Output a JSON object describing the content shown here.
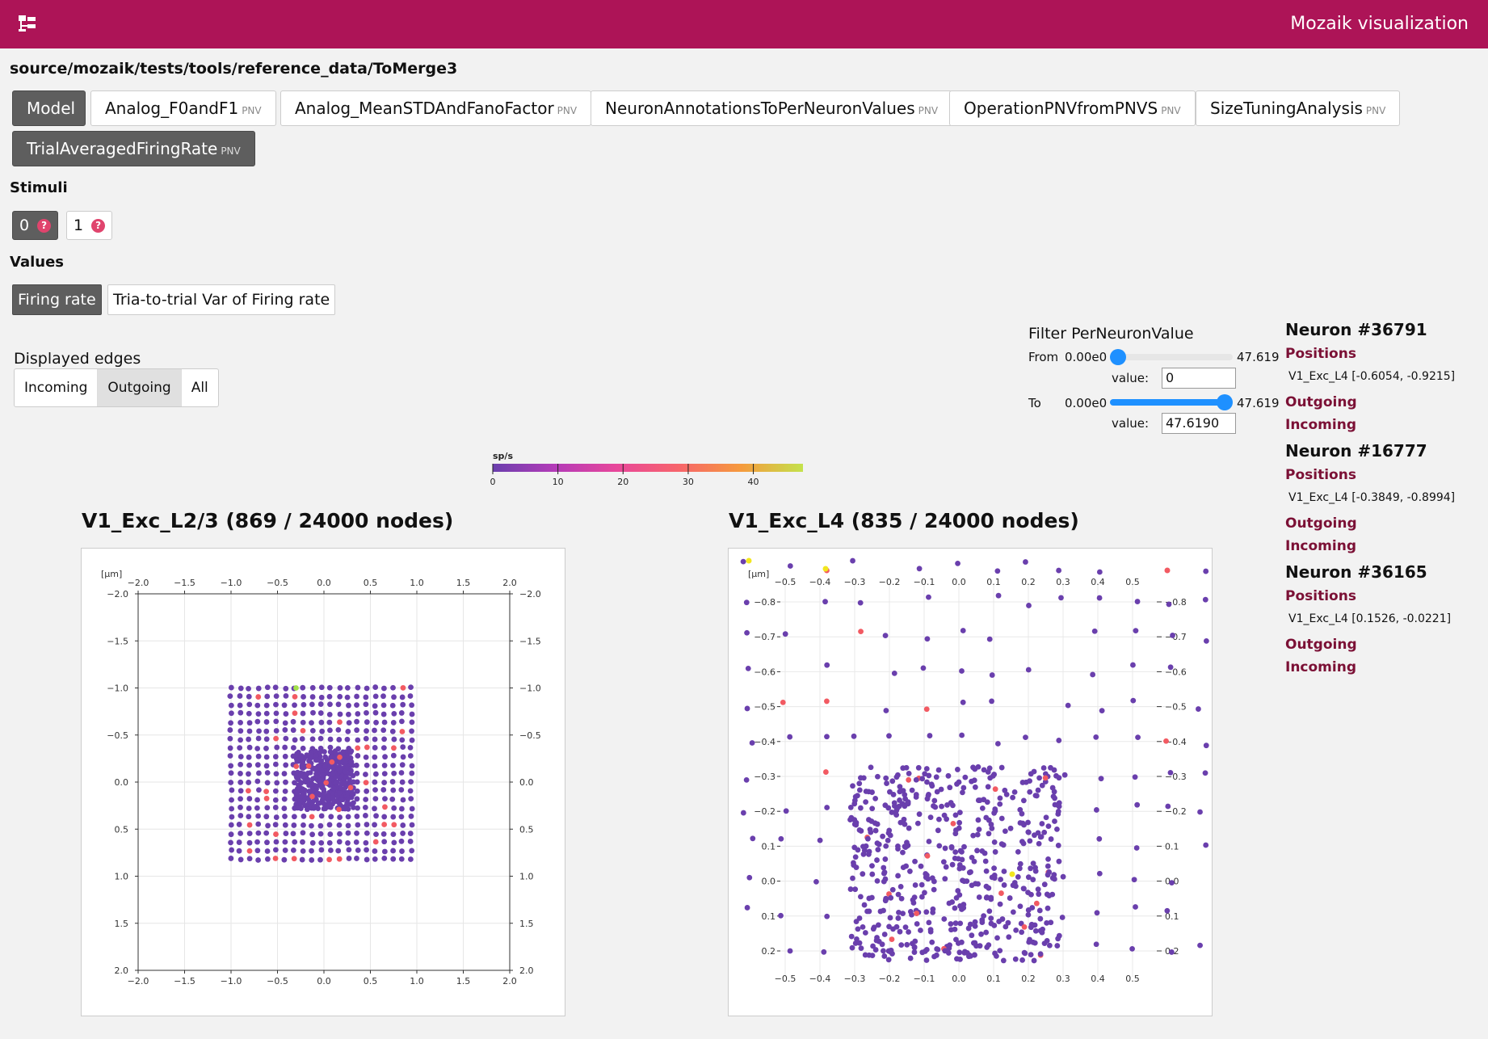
{
  "header": {
    "app_title": "Mozaik visualization",
    "menu_icon": "tree-menu-icon"
  },
  "path": "source/mozaik/tests/tools/reference_data/ToMerge3",
  "tabs": [
    {
      "label": "Model",
      "sub": "",
      "active": true
    },
    {
      "label": "Analog_F0andF1",
      "sub": "PNV"
    },
    {
      "label": "Analog_MeanSTDAndFanoFactor",
      "sub": "PNV"
    },
    {
      "label": "NeuronAnnotationsToPerNeuronValues",
      "sub": "PNV"
    },
    {
      "label": "OperationPNVfromPNVS",
      "sub": "PNV"
    },
    {
      "label": "SizeTuningAnalysis",
      "sub": "PNV"
    },
    {
      "label": "TrialAveragedFiringRate",
      "sub": "PNV"
    }
  ],
  "stimuli": {
    "label": "Stimuli",
    "items": [
      {
        "label": "0",
        "active": true
      },
      {
        "label": "1"
      }
    ],
    "help_icon": "question-circle-icon"
  },
  "values": {
    "label": "Values",
    "items": [
      {
        "label": "Firing rate",
        "active": true
      },
      {
        "label": "Tria-to-trial Var of Firing rate"
      }
    ]
  },
  "edges": {
    "label": "Displayed edges",
    "options": [
      "Incoming",
      "Outgoing",
      "All"
    ],
    "selected": "Outgoing"
  },
  "filter": {
    "title": "Filter PerNeuronValue",
    "from_label": "From",
    "to_label": "To",
    "min_label": "0.00e0",
    "max_label": "47.619",
    "value_label": "value:",
    "from_value": "0",
    "to_value": "47.6190",
    "from_fraction": 0.0,
    "to_fraction": 1.0
  },
  "colorbar": {
    "unit": "sp/s",
    "ticks": [
      "0",
      "10",
      "20",
      "30",
      "40"
    ],
    "tick_values": [
      0,
      10,
      20,
      30,
      40
    ],
    "max": 47.619,
    "colors": [
      "#6a3fad",
      "#b43bb8",
      "#e8479a",
      "#f7656b",
      "#f69a3d",
      "#c4e24c"
    ]
  },
  "plots": [
    {
      "title": "V1_Exc_L2/3 (869 / 24000 nodes)",
      "unit": "[μm]",
      "ticks": [
        "−2.0",
        "−1.5",
        "−1.0",
        "−0.5",
        "0.0",
        "0.5",
        "1.0",
        "1.5",
        "2.0"
      ],
      "yticks": [
        "−2.0",
        "−1.5",
        "−1.0",
        "−0.5",
        "0.0",
        "0.5",
        "1.0",
        "1.5",
        "2.0"
      ]
    },
    {
      "title": "V1_Exc_L4 (835 / 24000 nodes)",
      "unit": "[μm]",
      "ticks": [
        "−0.5",
        "−0.4",
        "−0.3",
        "−0.2",
        "−0.1",
        "0.0",
        "0.1",
        "0.2",
        "0.3",
        "0.4",
        "0.5"
      ],
      "yticks": [
        "−0.8",
        "−0.7",
        "−0.6",
        "−0.5",
        "−0.4",
        "−0.3",
        "−0.2",
        "0.1",
        "0.0",
        "0.1",
        "0.2"
      ]
    }
  ],
  "point_colors": {
    "base": "#6a3fad",
    "hot": "#f25a62",
    "green": "#a3e04a",
    "yellow": "#f2e61f"
  },
  "neurons": [
    {
      "title": "Neuron #36791",
      "positions_label": "Positions",
      "position": "V1_Exc_L4 [-0.6054, -0.9215]",
      "outgoing": "Outgoing",
      "incoming": "Incoming"
    },
    {
      "title": "Neuron #16777",
      "positions_label": "Positions",
      "position": "V1_Exc_L4 [-0.3849, -0.8994]",
      "outgoing": "Outgoing",
      "incoming": "Incoming"
    },
    {
      "title": "Neuron #36165",
      "positions_label": "Positions",
      "position": "V1_Exc_L4 [0.1526, -0.0221]",
      "outgoing": "Outgoing",
      "incoming": "Incoming"
    }
  ]
}
